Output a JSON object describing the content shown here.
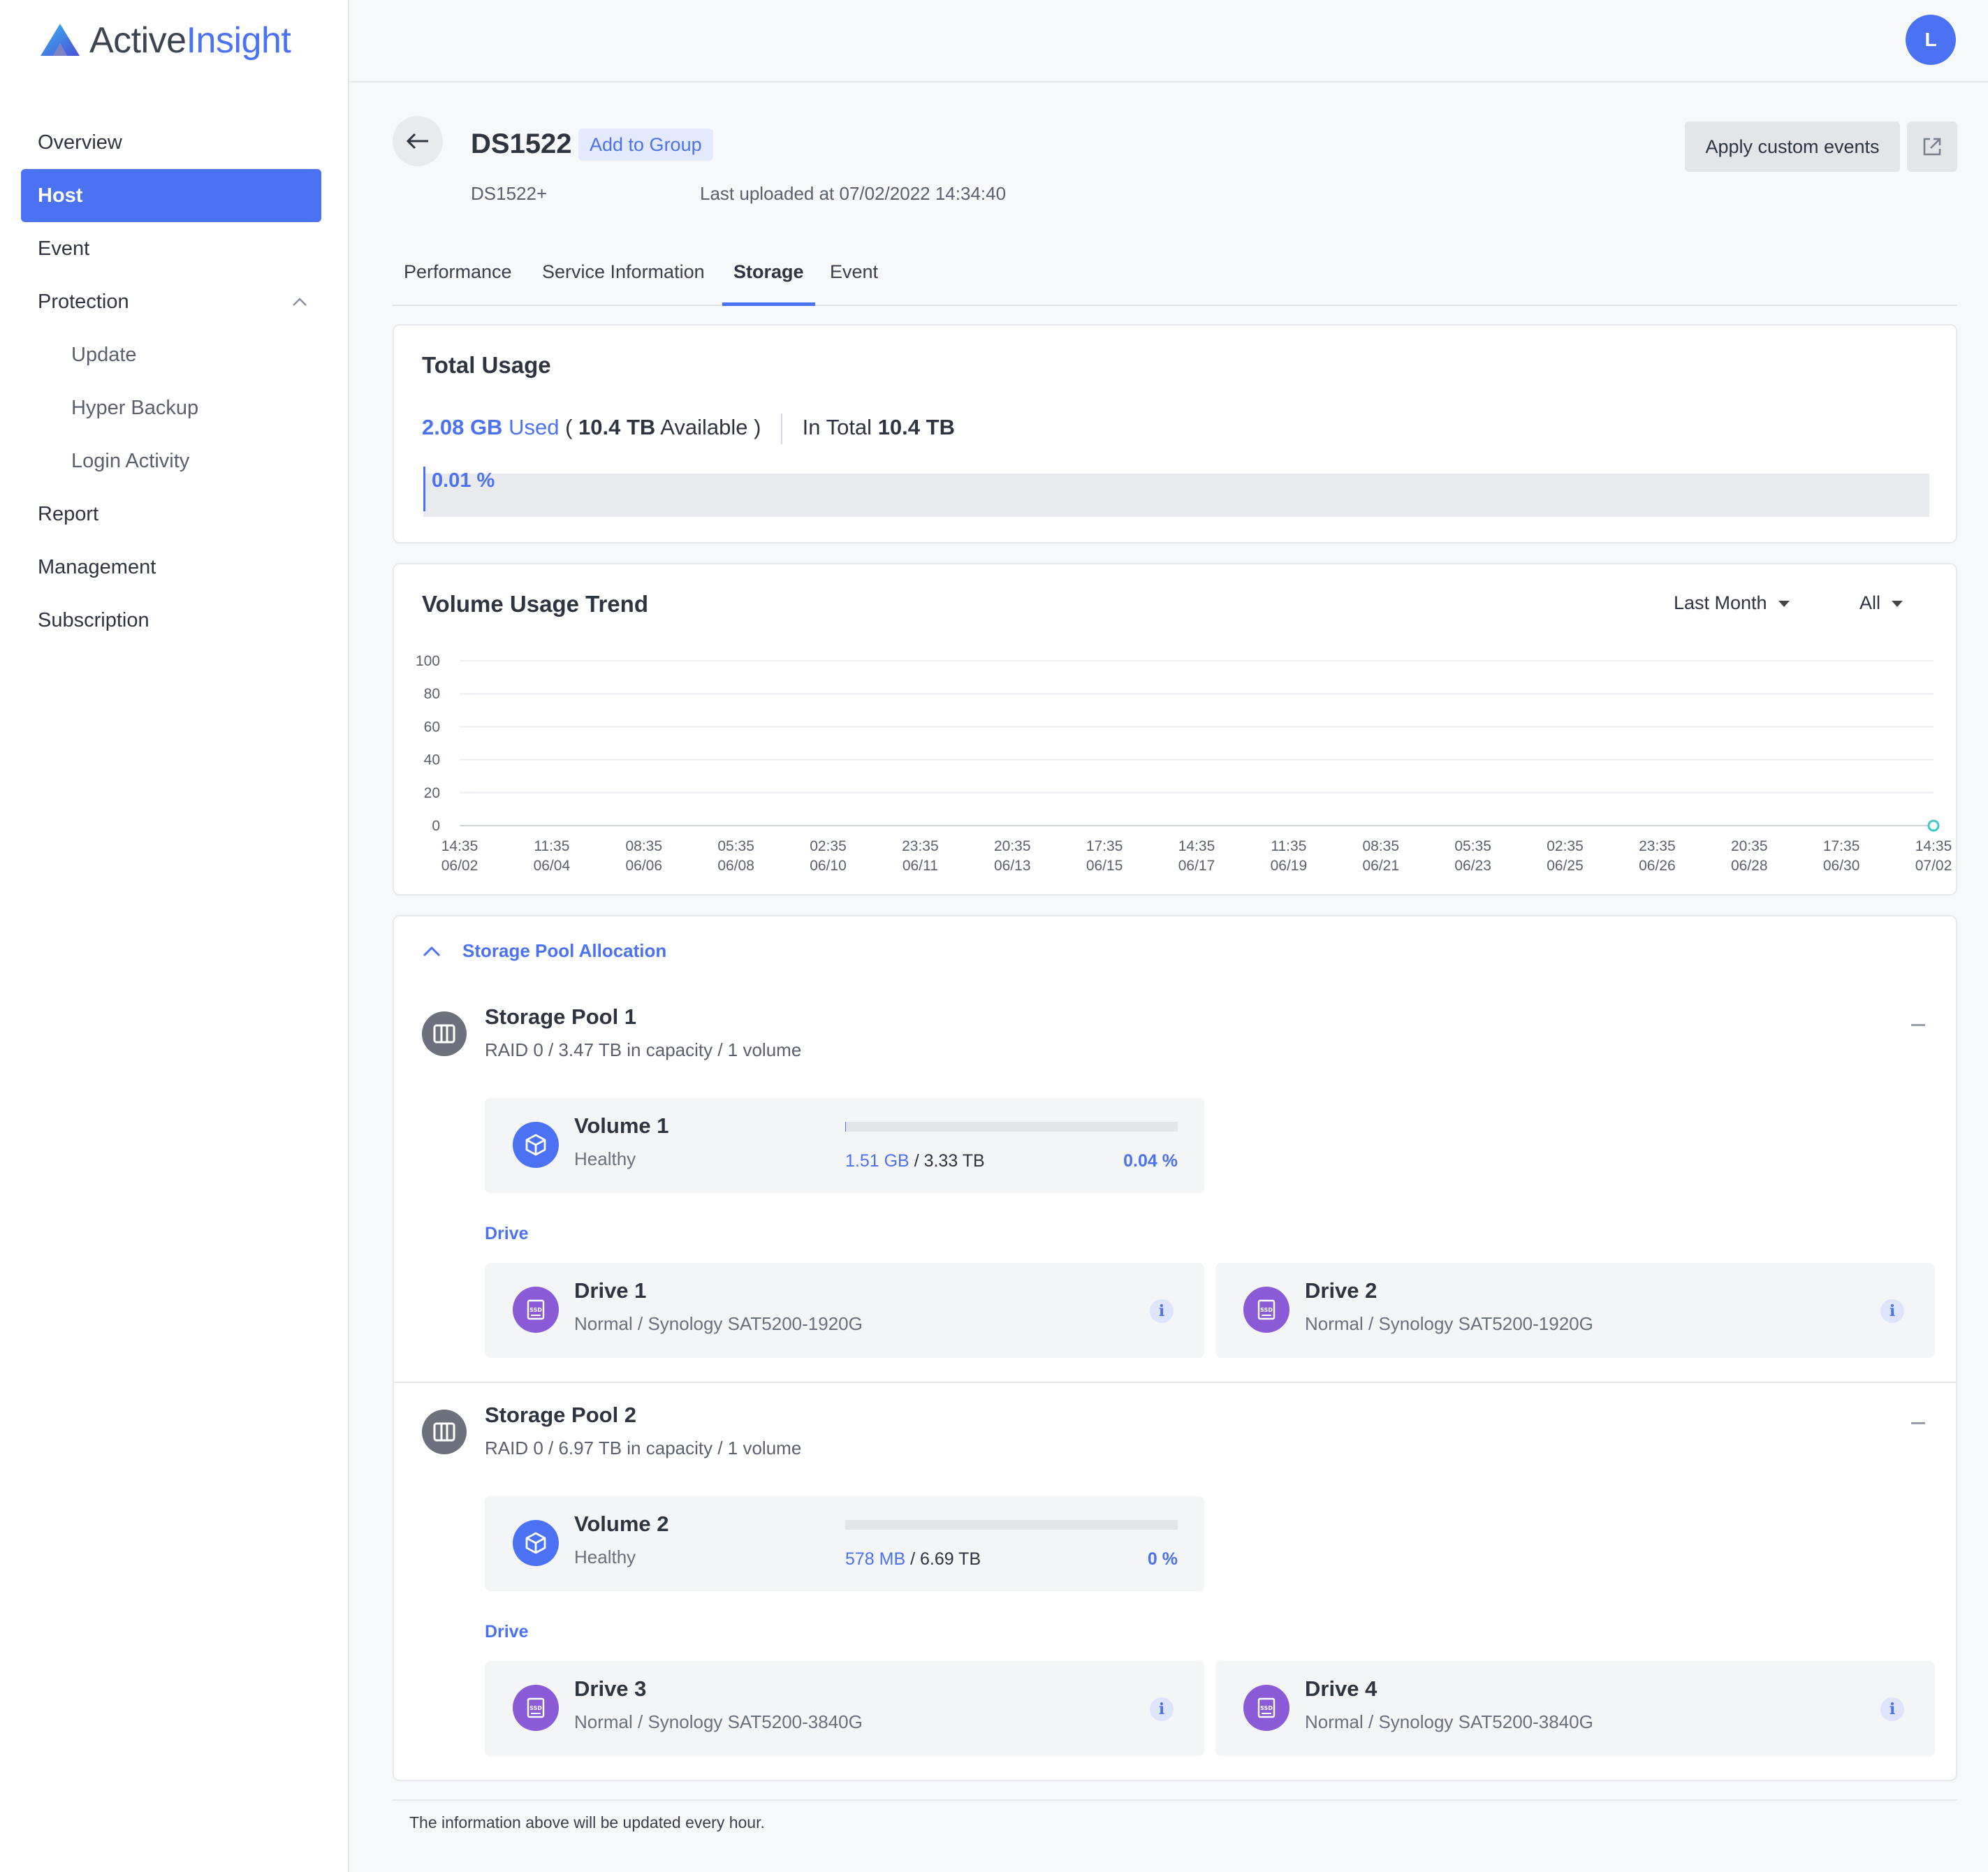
{
  "app": {
    "logo_part1": "Active",
    "logo_part2": "Insight",
    "user_initial": "L"
  },
  "sidebar": {
    "items": [
      {
        "label": "Overview"
      },
      {
        "label": "Host",
        "active": true
      },
      {
        "label": "Event"
      },
      {
        "label": "Protection",
        "expanded": true
      },
      {
        "label": "Update",
        "sub": true
      },
      {
        "label": "Hyper Backup",
        "sub": true
      },
      {
        "label": "Login Activity",
        "sub": true
      },
      {
        "label": "Report"
      },
      {
        "label": "Management"
      },
      {
        "label": "Subscription"
      }
    ]
  },
  "header": {
    "host_name": "DS1522",
    "add_to_group": "Add to Group",
    "model": "DS1522+",
    "last_uploaded": "Last uploaded at 07/02/2022 14:34:40",
    "apply_custom_events": "Apply custom events"
  },
  "tabs": [
    {
      "label": "Performance"
    },
    {
      "label": "Service Information"
    },
    {
      "label": "Storage",
      "active": true
    },
    {
      "label": "Event"
    }
  ],
  "total_usage": {
    "title": "Total Usage",
    "used_value": "2.08 GB",
    "used_label": "Used",
    "available_value": "10.4 TB",
    "available_label": "Available",
    "total_label": "In Total",
    "total_value": "10.4 TB",
    "percent_text": "0.01 %",
    "percent": 0.01
  },
  "trend": {
    "title": "Volume Usage Trend",
    "range_filter": "Last Month",
    "volume_filter": "All"
  },
  "chart_data": {
    "type": "line",
    "title": "Volume Usage Trend",
    "ylim": [
      0,
      100
    ],
    "y_ticks": [
      "100",
      "80",
      "60",
      "40",
      "20",
      "0"
    ],
    "x_ticks": [
      [
        "14:35",
        "06/02"
      ],
      [
        "11:35",
        "06/04"
      ],
      [
        "08:35",
        "06/06"
      ],
      [
        "05:35",
        "06/08"
      ],
      [
        "02:35",
        "06/10"
      ],
      [
        "23:35",
        "06/11"
      ],
      [
        "20:35",
        "06/13"
      ],
      [
        "17:35",
        "06/15"
      ],
      [
        "14:35",
        "06/17"
      ],
      [
        "11:35",
        "06/19"
      ],
      [
        "08:35",
        "06/21"
      ],
      [
        "05:35",
        "06/23"
      ],
      [
        "02:35",
        "06/25"
      ],
      [
        "23:35",
        "06/26"
      ],
      [
        "20:35",
        "06/28"
      ],
      [
        "17:35",
        "06/30"
      ],
      [
        "14:35",
        "07/02"
      ]
    ],
    "series": [
      {
        "points": [
          {
            "x": "07/02 14:35",
            "y": 0.01
          }
        ],
        "color": "#3cc9c9"
      }
    ],
    "grid": true
  },
  "storage": {
    "section_label": "Storage Pool Allocation",
    "drive_label": "Drive",
    "pools": [
      {
        "name": "Storage Pool 1",
        "desc": "RAID 0 / 3.47 TB in capacity / 1 volume",
        "volume": {
          "name": "Volume 1",
          "status": "Healthy",
          "used": "1.51 GB",
          "total": "/ 3.33 TB",
          "percent_text": "0.04 %",
          "percent": 0.04
        },
        "drives": [
          {
            "name": "Drive 1",
            "desc": "Normal / Synology SAT5200-1920G"
          },
          {
            "name": "Drive 2",
            "desc": "Normal / Synology SAT5200-1920G"
          }
        ]
      },
      {
        "name": "Storage Pool 2",
        "desc": "RAID 0 / 6.97 TB in capacity / 1 volume",
        "volume": {
          "name": "Volume 2",
          "status": "Healthy",
          "used": "578 MB",
          "total": "/ 6.69 TB",
          "percent_text": "0 %",
          "percent": 0
        },
        "drives": [
          {
            "name": "Drive 3",
            "desc": "Normal / Synology SAT5200-3840G"
          },
          {
            "name": "Drive 4",
            "desc": "Normal / Synology SAT5200-3840G"
          }
        ]
      }
    ]
  },
  "footer_note": "The information above will be updated every hour.",
  "colors": {
    "accent": "#4b72f2",
    "ssd": "#8a5ad7",
    "pool_icon": "#6c717d",
    "trend_point": "#3cc9c9"
  }
}
